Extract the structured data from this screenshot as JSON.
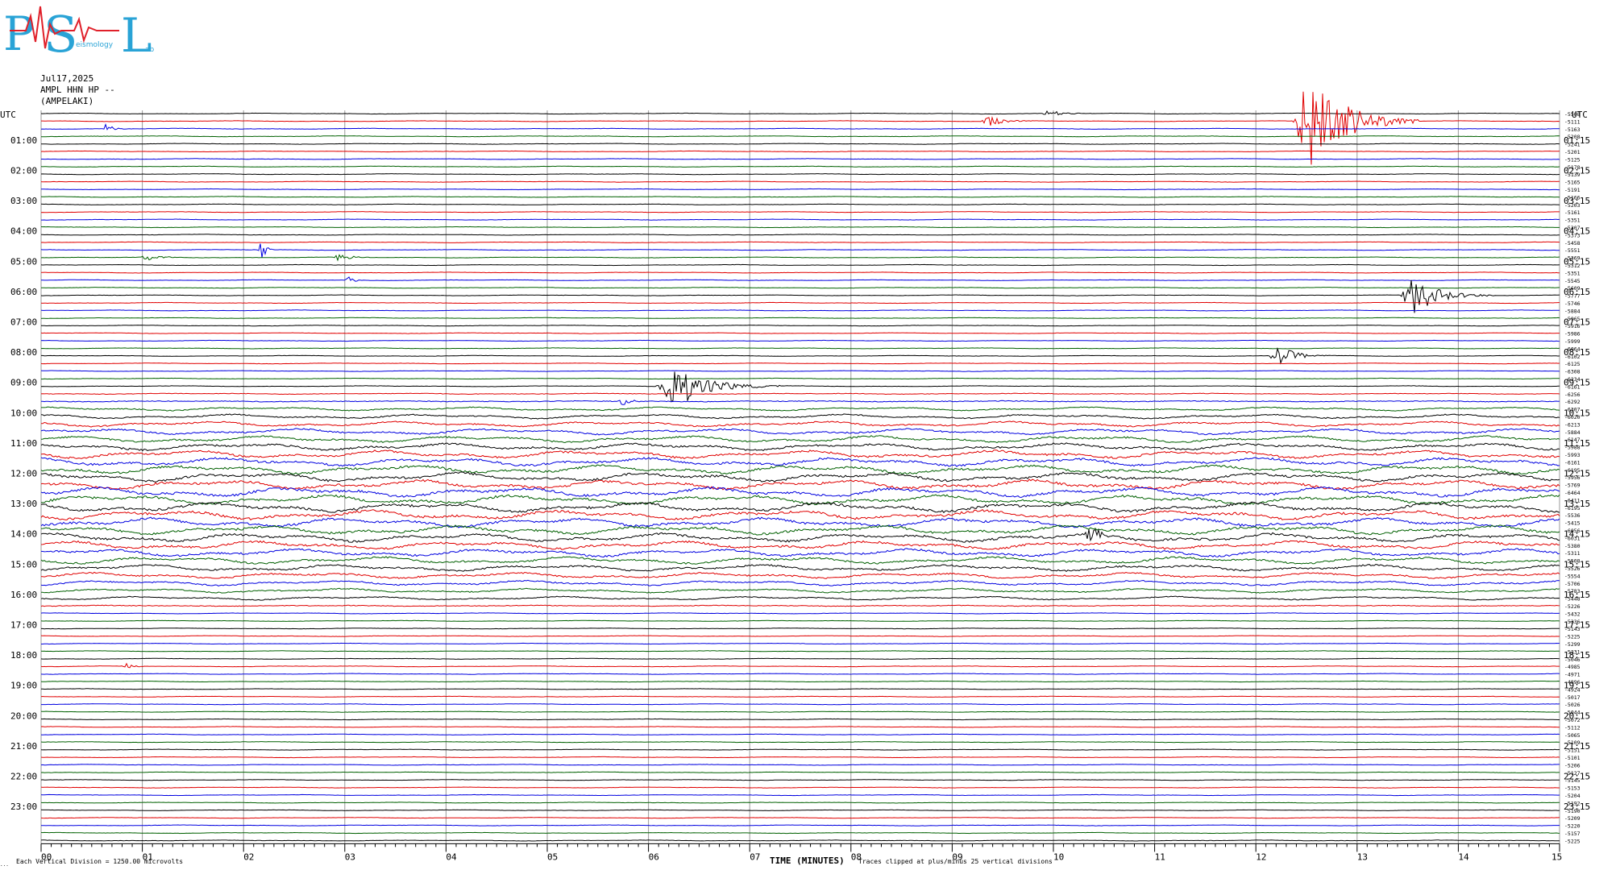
{
  "logo": {
    "letters": [
      "P",
      "S",
      "L"
    ],
    "subtitle_parts": [
      "eismology",
      "ab"
    ],
    "primary_color": "#29a3d6",
    "accent_color": "#e0202a"
  },
  "header": {
    "date": "Jul17,2025",
    "station": "AMPL HHN HP --",
    "location": "(AMPELAKI)"
  },
  "axis": {
    "left_title": "UTC",
    "right_title": "UTC",
    "x_title": "TIME (MINUTES)",
    "x_note": "Traces clipped at plus/minus 25 vertical divisions",
    "scale_note": "Each Vertical Division = 1250.00 microvolts",
    "corner_mark": "..."
  },
  "chart_data": {
    "type": "line",
    "title": "",
    "x_ticks": [
      "00",
      "01",
      "02",
      "03",
      "04",
      "05",
      "06",
      "07",
      "08",
      "09",
      "10",
      "11",
      "12",
      "13",
      "14",
      "15"
    ],
    "xlim": [
      0,
      15
    ],
    "left_hour_labels": [
      "01:00",
      "02:00",
      "03:00",
      "04:00",
      "05:00",
      "06:00",
      "07:00",
      "08:00",
      "09:00",
      "10:00",
      "11:00",
      "12:00",
      "13:00",
      "14:00",
      "15:00",
      "16:00",
      "17:00",
      "18:00",
      "19:00",
      "20:00",
      "21:00",
      "22:00",
      "23:00"
    ],
    "right_hour_labels": [
      "01:15",
      "02:15",
      "03:15",
      "04:15",
      "05:15",
      "06:15",
      "07:15",
      "08:15",
      "09:15",
      "10:15",
      "11:15",
      "12:15",
      "13:15",
      "14:15",
      "15:15",
      "16:15",
      "17:15",
      "18:15",
      "19:15",
      "20:15",
      "21:15",
      "22:15",
      "23:15"
    ],
    "trace_colors": [
      "#000000",
      "#e00000",
      "#0000e0",
      "#006000"
    ],
    "trace_offsets": [
      -5508,
      -5111,
      -5163,
      -5208,
      -5241,
      -5201,
      -5125,
      -5178,
      -5139,
      -5165,
      -5191,
      -5166,
      -5203,
      -5161,
      -5351,
      -5307,
      -5373,
      -5458,
      -5551,
      -5369,
      -5312,
      -5351,
      -5545,
      -5609,
      -5777,
      -5746,
      -5884,
      -5965,
      -5916,
      -5986,
      -5999,
      -6064,
      -6102,
      -6125,
      -6308,
      -6234,
      -6161,
      -6256,
      -6292,
      -6307,
      -6020,
      -6213,
      -5884,
      -6147,
      -5988,
      -5993,
      -6161,
      -6195,
      -5956,
      -5769,
      -6464,
      -6411,
      -6195,
      -5536,
      -5415,
      -6056,
      -6031,
      -5380,
      -5311,
      -5508,
      -5526,
      -5554,
      -5706,
      -5783,
      -5448,
      -5226,
      -5432,
      -5336,
      -5143,
      -5225,
      -5299,
      -5231,
      -5046,
      -4985,
      -4971,
      -4896,
      -4924,
      -5017,
      -5026,
      -5044,
      -5072,
      -5112,
      -5065,
      -5109,
      -5151,
      -5101,
      -5206,
      -5127,
      -5145,
      -5153,
      -5204,
      -5192,
      -5190,
      -5209,
      -5220,
      -5157,
      -5225
    ],
    "events": [
      {
        "row": 0,
        "minute": 9.9,
        "amp": 0.5,
        "dur": 0.5
      },
      {
        "row": 1,
        "minute": 9.3,
        "amp": 0.7,
        "dur": 0.5
      },
      {
        "row": 1,
        "minute": 12.4,
        "amp": 7.0,
        "dur": 1.2
      },
      {
        "row": 2,
        "minute": 0.6,
        "amp": 0.6,
        "dur": 0.3
      },
      {
        "row": 18,
        "minute": 2.15,
        "amp": 2.0,
        "dur": 0.15
      },
      {
        "row": 19,
        "minute": 1.0,
        "amp": 0.5,
        "dur": 0.4
      },
      {
        "row": 19,
        "minute": 2.9,
        "amp": 0.6,
        "dur": 0.4
      },
      {
        "row": 22,
        "minute": 3.0,
        "amp": 0.7,
        "dur": 0.2
      },
      {
        "row": 24,
        "minute": 13.45,
        "amp": 2.5,
        "dur": 0.9
      },
      {
        "row": 32,
        "minute": 12.15,
        "amp": 1.5,
        "dur": 0.6
      },
      {
        "row": 36,
        "minute": 6.1,
        "amp": 3.0,
        "dur": 1.2
      },
      {
        "row": 38,
        "minute": 5.7,
        "amp": 0.6,
        "dur": 0.3
      },
      {
        "row": 56,
        "minute": 10.3,
        "amp": 0.9,
        "dur": 0.5
      },
      {
        "row": 73,
        "minute": 0.8,
        "amp": 0.4,
        "dur": 0.3
      }
    ]
  }
}
